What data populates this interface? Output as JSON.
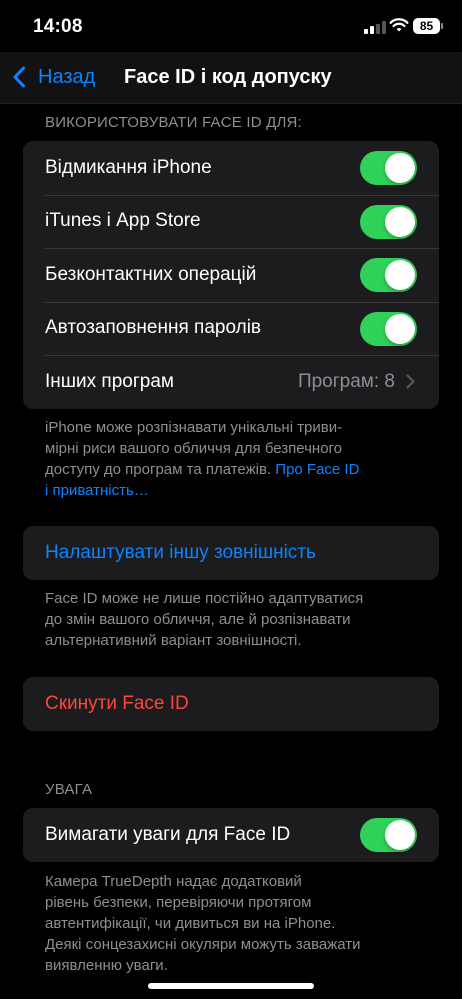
{
  "status_bar": {
    "time": "14:08",
    "battery": "85"
  },
  "nav": {
    "back_label": "Назад",
    "title": "Face ID і код допуску"
  },
  "use_section": {
    "header": "ВИКОРИСТОВУВАТИ FACE ID ДЛЯ:",
    "rows": [
      {
        "label": "Відмикання iPhone",
        "toggle_on": true
      },
      {
        "label": "iTunes і App Store",
        "toggle_on": true
      },
      {
        "label": "Безконтактних операцій",
        "toggle_on": true
      },
      {
        "label": "Автозаповнення паролів",
        "toggle_on": true
      }
    ],
    "other_apps": {
      "label": "Інших програм",
      "value": "Програм: 8"
    },
    "footer_line1": "iPhone може розпізнавати унікальні триви-",
    "footer_line2": "мірні риси вашого обличчя для безпечного",
    "footer_line3": "доступу до програм та платежів.",
    "footer_link_part1": "Про Face ID",
    "footer_link_part2": "і приватність…"
  },
  "alternate_appearance": {
    "label": "Налаштувати іншу зовнішність",
    "footer_line1": "Face ID може не лише постійно адаптуватися",
    "footer_line2": "до змін вашого обличчя, але й розпізнавати",
    "footer_line3": "альтернативний варіант зовнішності."
  },
  "reset": {
    "label": "Скинути Face ID"
  },
  "attention_section": {
    "header": "УВАГА",
    "row": {
      "label": "Вимагати уваги для Face ID",
      "toggle_on": true
    },
    "footer_line1": "Камера TrueDepth надає додатковий",
    "footer_line2": "рівень безпеки, перевіряючи протягом",
    "footer_line3": "автентифікації, чи дивиться ви на iPhone.",
    "footer_line4": "Деякі сонцезахисні окуляри можуть заважати",
    "footer_line5": "виявленню уваги."
  },
  "colors": {
    "accent": "#0a84ff",
    "toggle_on": "#30d158",
    "destructive": "#ff453a",
    "cell_background": "#1c1c1e",
    "secondary_text": "#8e8e93"
  },
  "icons": [
    "signal-icon",
    "wifi-icon",
    "battery-icon",
    "chevron-left-icon",
    "chevron-right-icon"
  ]
}
